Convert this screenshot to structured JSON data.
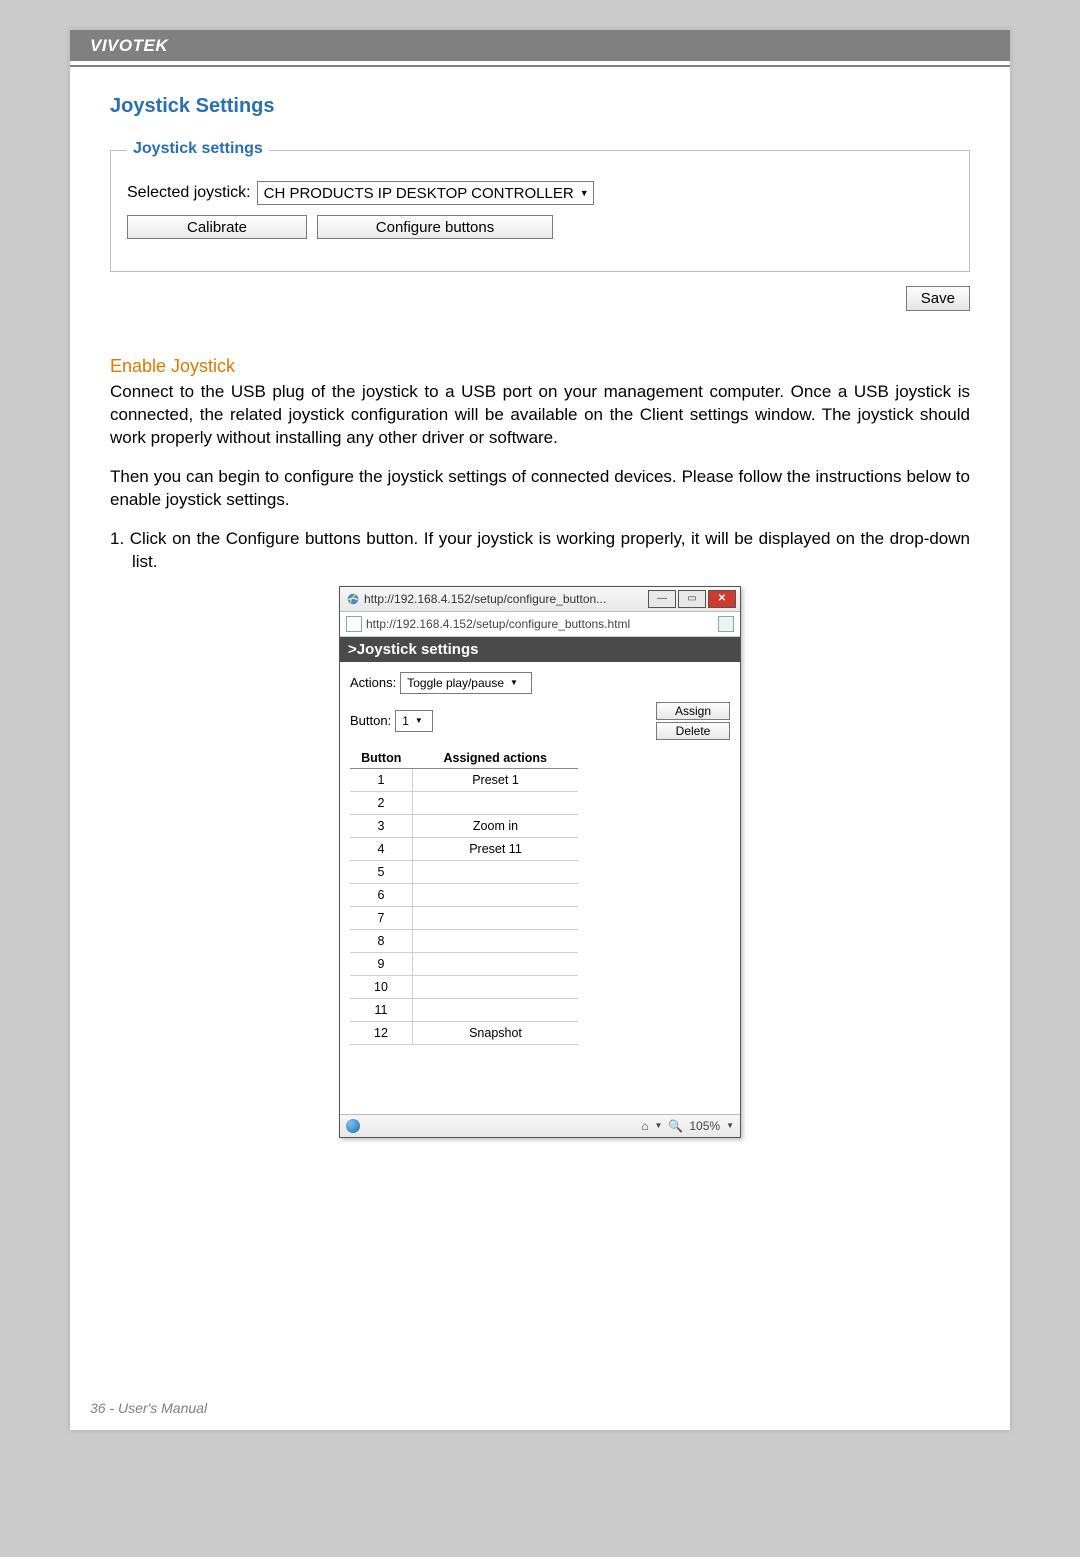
{
  "header": {
    "brand": "VIVOTEK"
  },
  "title": "Joystick Settings",
  "panel": {
    "legend": "Joystick settings",
    "selected_label": "Selected joystick:",
    "selected_value": "CH PRODUCTS IP DESKTOP CONTROLLER",
    "calibrate_btn": "Calibrate",
    "configure_btn": "Configure buttons",
    "save_btn": "Save"
  },
  "subheading": "Enable Joystick",
  "para1": "Connect to the USB plug of the joystick to a USB port on your management computer. Once a USB joystick is connected, the related joystick configuration will be available on the Client settings window. The joystick should work properly without installing any other driver or software.",
  "para2": "Then you can begin to configure the joystick settings of connected devices. Please follow the instructions below to enable joystick settings.",
  "step1": "1. Click on the Configure buttons button. If your joystick is working properly, it will be displayed on the drop-down list.",
  "popup": {
    "title": "http://192.168.4.152/setup/configure_button...",
    "address": "http://192.168.4.152/setup/configure_buttons.html",
    "section_title": ">Joystick settings",
    "actions_label": "Actions:",
    "actions_value": "Toggle play/pause",
    "button_label": "Button:",
    "button_value": "1",
    "assign_btn": "Assign",
    "delete_btn": "Delete",
    "col_button": "Button",
    "col_actions": "Assigned actions",
    "rows": [
      {
        "btn": "1",
        "action": "Preset 1"
      },
      {
        "btn": "2",
        "action": ""
      },
      {
        "btn": "3",
        "action": "Zoom in"
      },
      {
        "btn": "4",
        "action": "Preset 11"
      },
      {
        "btn": "5",
        "action": ""
      },
      {
        "btn": "6",
        "action": ""
      },
      {
        "btn": "7",
        "action": ""
      },
      {
        "btn": "8",
        "action": ""
      },
      {
        "btn": "9",
        "action": ""
      },
      {
        "btn": "10",
        "action": ""
      },
      {
        "btn": "11",
        "action": ""
      },
      {
        "btn": "12",
        "action": "Snapshot"
      }
    ],
    "zoom_level": "105%"
  },
  "footer": "36 - User's Manual"
}
